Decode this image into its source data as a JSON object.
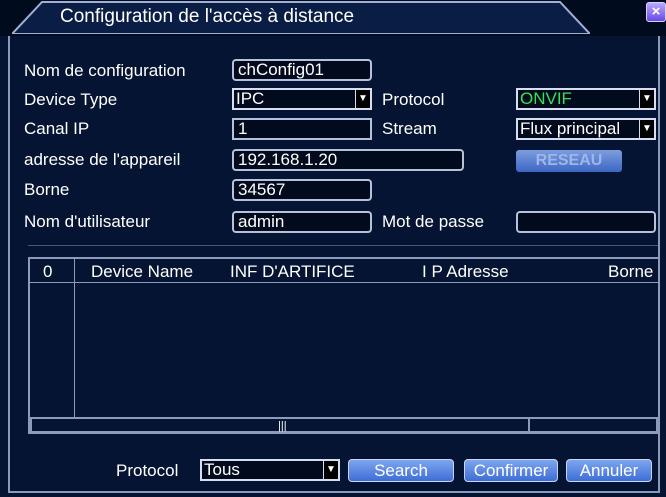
{
  "window": {
    "title": "Configuration de l'accès à distance"
  },
  "form": {
    "config_name_label": "Nom de configuration",
    "config_name_value": "chConfig01",
    "device_type_label": "Device Type",
    "device_type_value": "IPC",
    "protocol_label": "Protocol",
    "protocol_value": "ONVIF",
    "channel_label": "Canal IP",
    "channel_value": "1",
    "stream_label": "Stream",
    "stream_value": "Flux principal",
    "address_label": "adresse de l'appareil",
    "address_value": "192.168.1.20",
    "network_button": "RESEAU",
    "port_label": "Borne",
    "port_value": "34567",
    "username_label": "Nom d'utilisateur",
    "username_value": "admin",
    "password_label": "Mot de passe",
    "password_value": ""
  },
  "table": {
    "headers": [
      "0",
      "Device Name",
      "INF D'ARTIFICE",
      "I P Adresse",
      "Borne"
    ],
    "rows": []
  },
  "footer": {
    "protocol_label": "Protocol",
    "protocol_value": "Tous",
    "search_button": "Search",
    "confirm_button": "Confirmer",
    "cancel_button": "Annuler"
  },
  "colors": {
    "background": "#051432",
    "accent_green": "#38e05a",
    "button_blue": "#4a7ee0"
  }
}
